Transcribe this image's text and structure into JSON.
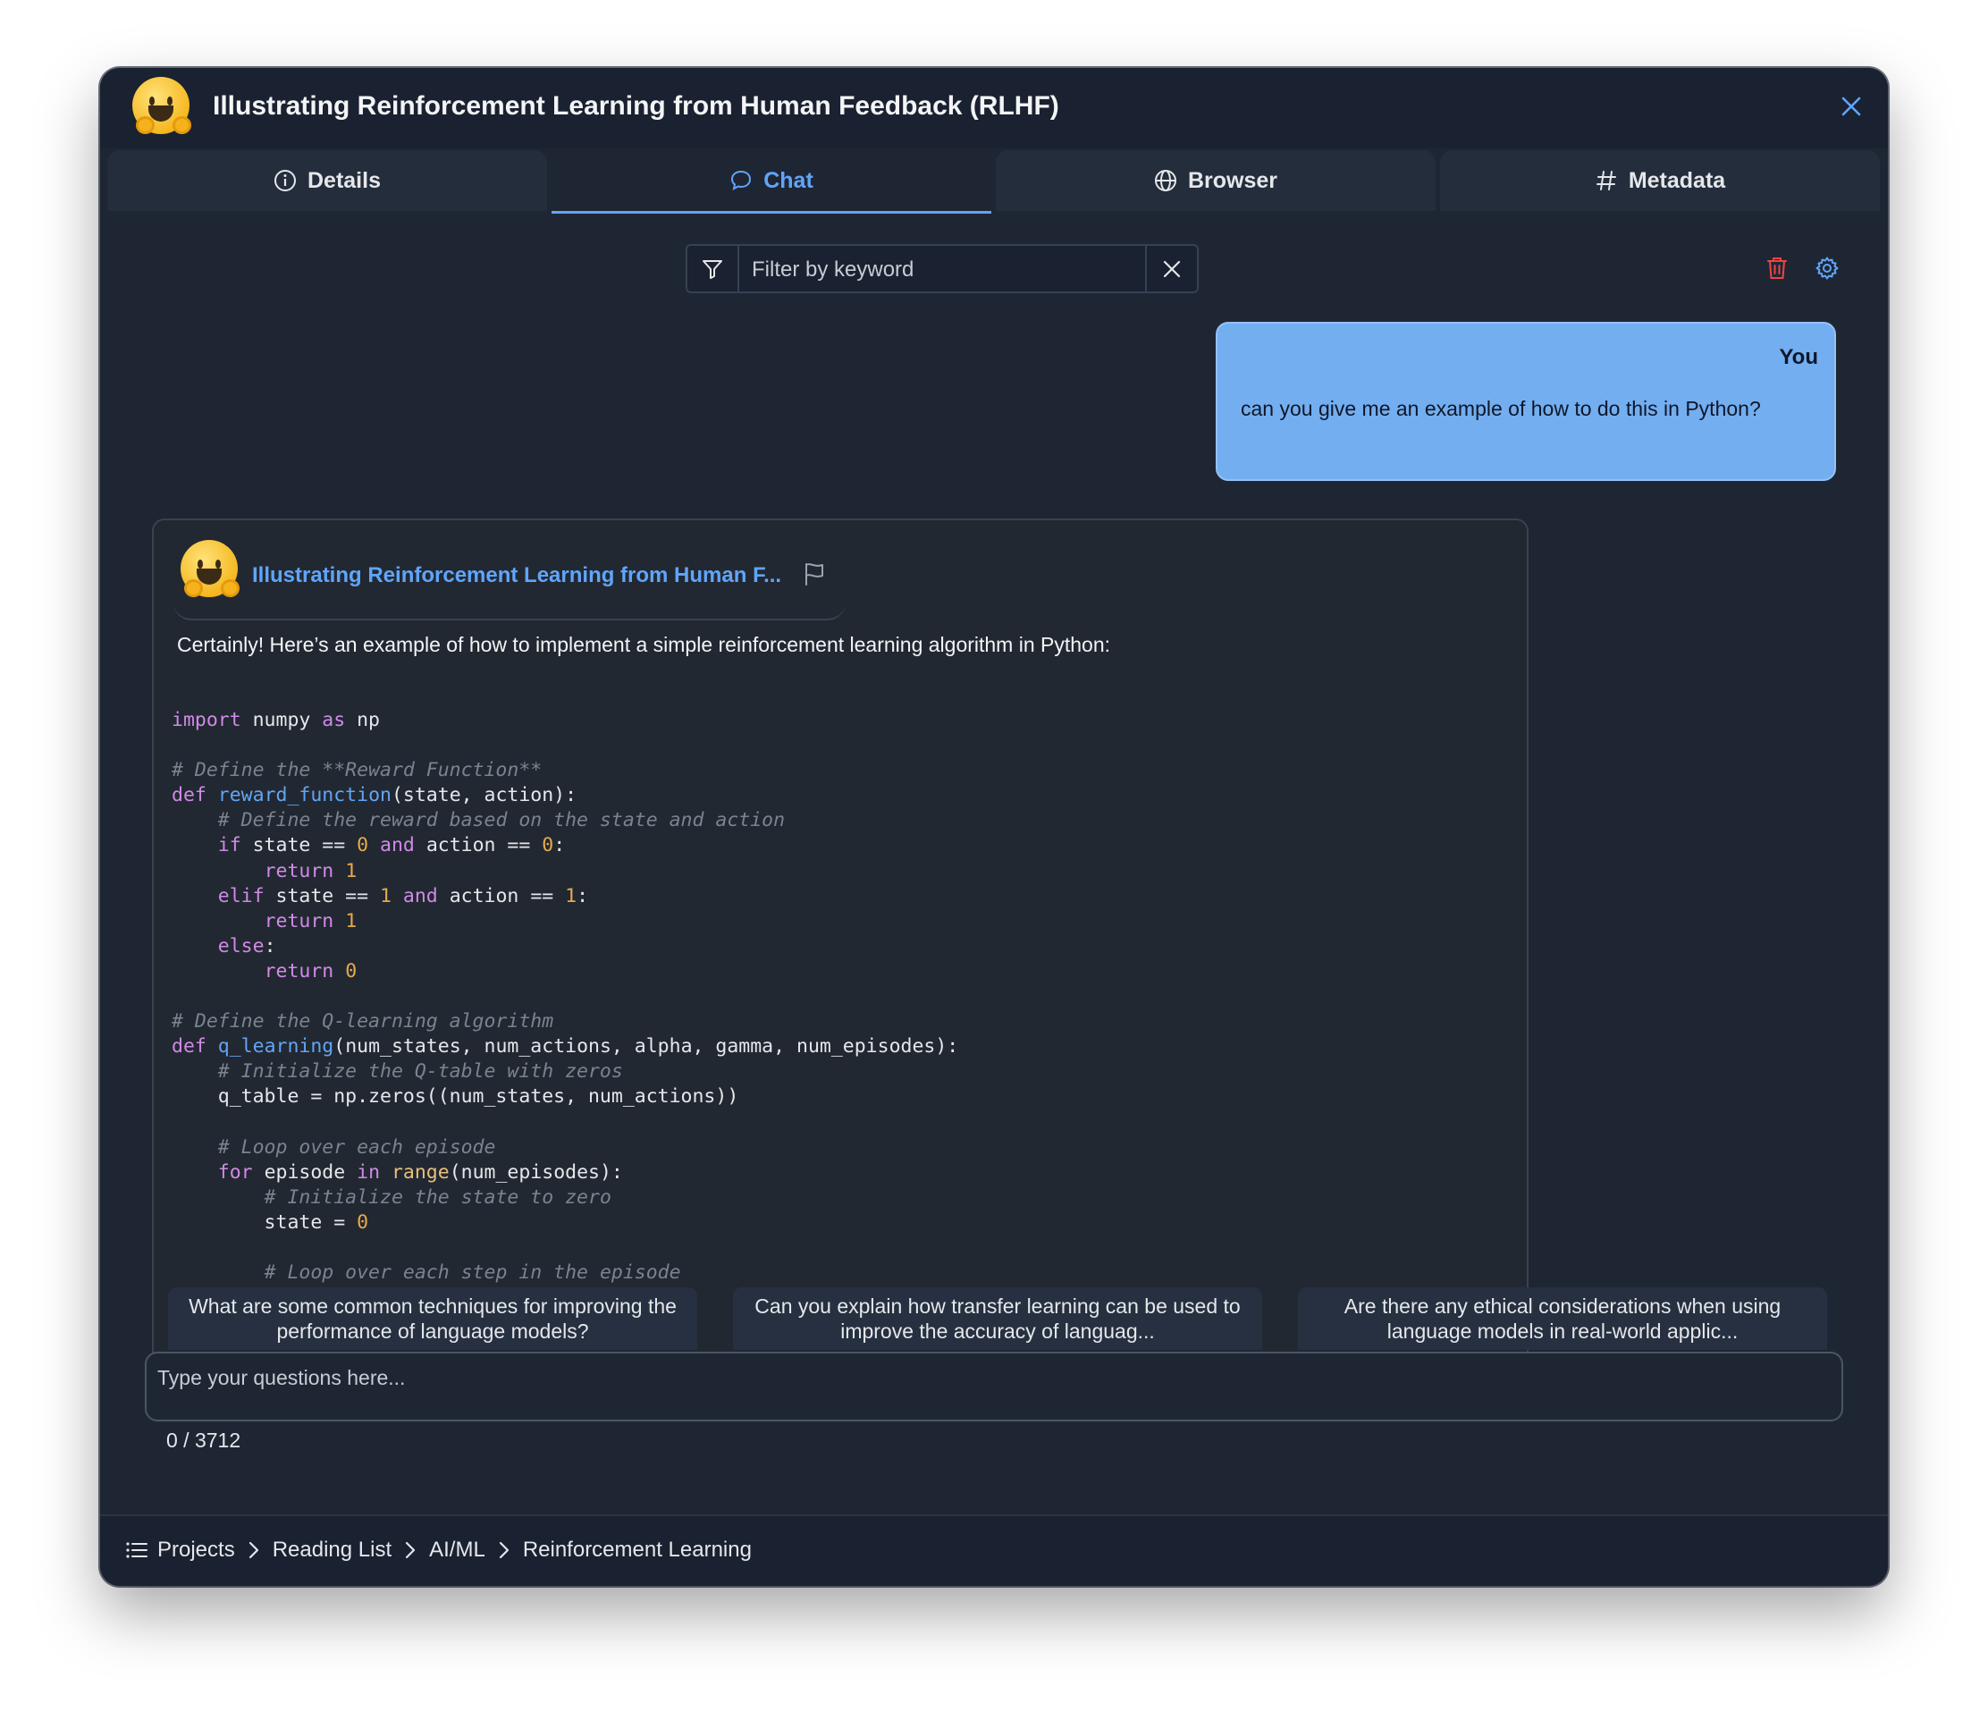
{
  "window": {
    "title": "Illustrating Reinforcement Learning from Human Feedback (RLHF)"
  },
  "tabs": [
    {
      "label": "Details",
      "icon": "info-icon"
    },
    {
      "label": "Chat",
      "icon": "chat-bubble-icon",
      "active": true
    },
    {
      "label": "Browser",
      "icon": "globe-icon"
    },
    {
      "label": "Metadata",
      "icon": "hash-icon"
    }
  ],
  "filter": {
    "placeholder": "Filter by keyword",
    "value": ""
  },
  "user_message": {
    "sender": "You",
    "text": "can you give me an example of how to do this in Python?"
  },
  "bot_message": {
    "name": "Illustrating Reinforcement Learning from Human F...",
    "intro": "Certainly! Here’s an example of how to implement a simple reinforcement learning algorithm in Python:",
    "code_lines": [
      [
        [
          "kw",
          "import"
        ],
        [
          "t",
          " numpy "
        ],
        [
          "kw",
          "as"
        ],
        [
          "t",
          " np"
        ]
      ],
      [],
      [
        [
          "cm",
          "# Define the **Reward Function**"
        ]
      ],
      [
        [
          "kw",
          "def"
        ],
        [
          "t",
          " "
        ],
        [
          "fn",
          "reward_function"
        ],
        [
          "t",
          "(state, action):"
        ]
      ],
      [
        [
          "t",
          "    "
        ],
        [
          "cm",
          "# Define the reward based on the state and action"
        ]
      ],
      [
        [
          "t",
          "    "
        ],
        [
          "kw",
          "if"
        ],
        [
          "t",
          " state == "
        ],
        [
          "num",
          "0"
        ],
        [
          "t",
          " "
        ],
        [
          "kw",
          "and"
        ],
        [
          "t",
          " action == "
        ],
        [
          "num",
          "0"
        ],
        [
          "t",
          ":"
        ]
      ],
      [
        [
          "t",
          "        "
        ],
        [
          "kw",
          "return"
        ],
        [
          "t",
          " "
        ],
        [
          "num",
          "1"
        ]
      ],
      [
        [
          "t",
          "    "
        ],
        [
          "kw",
          "elif"
        ],
        [
          "t",
          " state == "
        ],
        [
          "num",
          "1"
        ],
        [
          "t",
          " "
        ],
        [
          "kw",
          "and"
        ],
        [
          "t",
          " action == "
        ],
        [
          "num",
          "1"
        ],
        [
          "t",
          ":"
        ]
      ],
      [
        [
          "t",
          "        "
        ],
        [
          "kw",
          "return"
        ],
        [
          "t",
          " "
        ],
        [
          "num",
          "1"
        ]
      ],
      [
        [
          "t",
          "    "
        ],
        [
          "kw",
          "else"
        ],
        [
          "t",
          ":"
        ]
      ],
      [
        [
          "t",
          "        "
        ],
        [
          "kw",
          "return"
        ],
        [
          "t",
          " "
        ],
        [
          "num",
          "0"
        ]
      ],
      [],
      [
        [
          "cm",
          "# Define the Q-learning algorithm"
        ]
      ],
      [
        [
          "kw",
          "def"
        ],
        [
          "t",
          " "
        ],
        [
          "fn",
          "q_learning"
        ],
        [
          "t",
          "(num_states, num_actions, alpha, gamma, num_episodes):"
        ]
      ],
      [
        [
          "t",
          "    "
        ],
        [
          "cm",
          "# Initialize the Q-table with zeros"
        ]
      ],
      [
        [
          "t",
          "    q_table = np.zeros((num_states, num_actions))"
        ]
      ],
      [],
      [
        [
          "t",
          "    "
        ],
        [
          "cm",
          "# Loop over each episode"
        ]
      ],
      [
        [
          "t",
          "    "
        ],
        [
          "kw",
          "for"
        ],
        [
          "t",
          " episode "
        ],
        [
          "kw",
          "in"
        ],
        [
          "t",
          " "
        ],
        [
          "bi",
          "range"
        ],
        [
          "t",
          "(num_episodes):"
        ]
      ],
      [
        [
          "t",
          "        "
        ],
        [
          "cm",
          "# Initialize the state to zero"
        ]
      ],
      [
        [
          "t",
          "        state = "
        ],
        [
          "num",
          "0"
        ]
      ],
      [],
      [
        [
          "t",
          "        "
        ],
        [
          "cm",
          "# Loop over each step in the episode"
        ]
      ]
    ]
  },
  "suggestions": [
    "What are some common techniques for improving the performance of language models?",
    "Can you explain how transfer learning can be used to improve the accuracy of languag...",
    "Are there any ethical considerations when using language models in real-world applic..."
  ],
  "chat_input": {
    "placeholder": "Type your questions here...",
    "value": ""
  },
  "char_counter": "0 / 3712",
  "breadcrumbs": [
    "Projects",
    "Reading List",
    "AI/ML",
    "Reinforcement Learning"
  ],
  "colors": {
    "accent": "#60a5fa",
    "user_bubble": "#73aef0",
    "background": "#1f2633",
    "delete": "#ef4444"
  }
}
